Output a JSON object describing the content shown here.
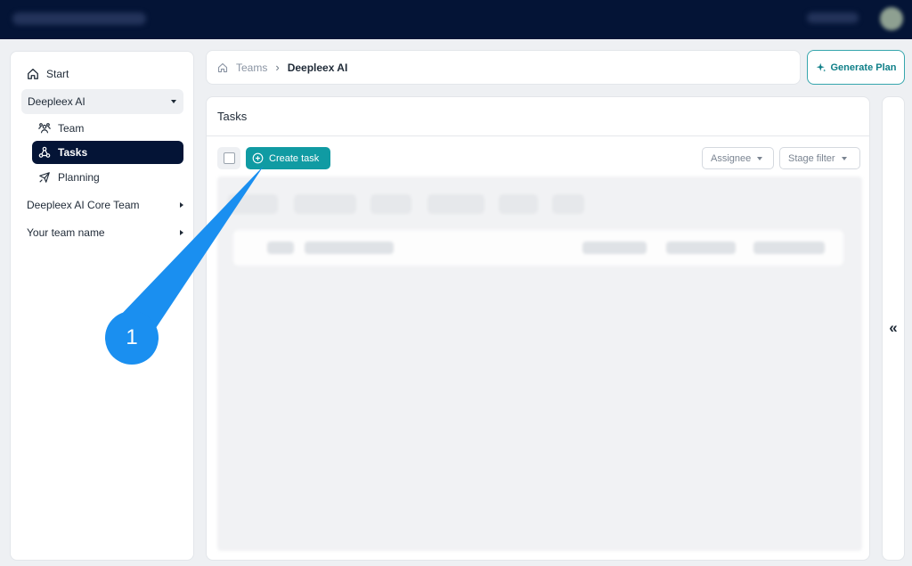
{
  "sidebar": {
    "start": "Start",
    "group": "Deepleex AI",
    "sub_items": [
      "Team",
      "Tasks",
      "Planning"
    ],
    "collapsed": [
      "Deepleex AI Core Team",
      "Your team name"
    ]
  },
  "breadcrumb": {
    "root": "Teams",
    "current": "Deepleex AI"
  },
  "generate_plan": "Generate Plan",
  "main": {
    "title": "Tasks",
    "create_task": "Create task",
    "filters": {
      "assignee": "Assignee",
      "stage": "Stage filter"
    }
  },
  "right_panel": {
    "collapse_glyph": "«"
  },
  "annotation": {
    "step": "1",
    "color": "#1a8ff0"
  },
  "colors": {
    "topbar": "#041436",
    "accent": "#109ba3",
    "active_nav": "#041436"
  }
}
